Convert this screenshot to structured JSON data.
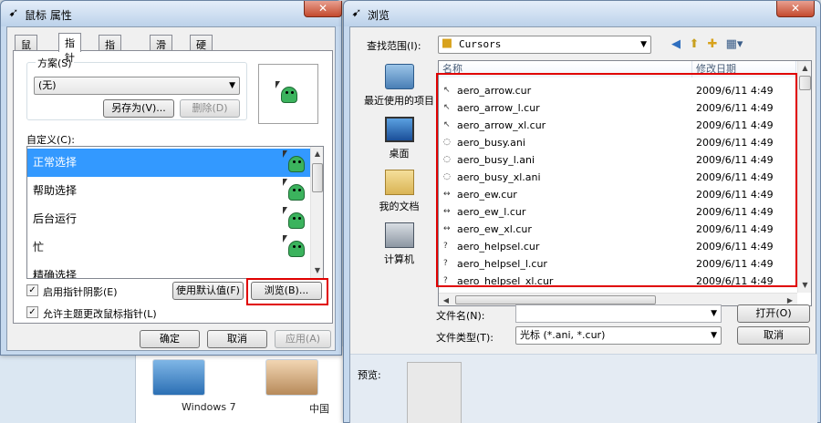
{
  "background": {
    "thumbs": [
      {
        "label": "Windows 7"
      },
      {
        "label": "中国"
      }
    ]
  },
  "mouse_props": {
    "title": "鼠标 属性",
    "close_label": "✕",
    "tabs": [
      "鼠标键",
      "指针",
      "指针选项",
      "滑轮",
      "硬件"
    ],
    "active_tab": "指针",
    "scheme_label": "方案(S)",
    "scheme_value": "(无)",
    "save_as_label": "另存为(V)...",
    "delete_label": "删除(D)",
    "customize_label": "自定义(C):",
    "cursors": [
      {
        "label": "正常选择",
        "selected": true
      },
      {
        "label": "帮助选择",
        "selected": false
      },
      {
        "label": "后台运行",
        "selected": false
      },
      {
        "label": "忙",
        "selected": false
      },
      {
        "label": "精确选择",
        "selected": false
      }
    ],
    "shadow_label": "启用指针阴影(E)",
    "shadow_checked": true,
    "theme_label": "允许主题更改鼠标指针(L)",
    "theme_checked": true,
    "use_default_label": "使用默认值(F)",
    "browse_label": "浏览(B)...",
    "ok_label": "确定",
    "cancel_label": "取消",
    "apply_label": "应用(A)"
  },
  "browse": {
    "title": "浏览",
    "close_label": "✕",
    "look_in_label": "查找范围(I):",
    "look_in_value": "Cursors",
    "places": [
      {
        "label": "最近使用的项目",
        "icon": "recent-items-icon"
      },
      {
        "label": "桌面",
        "icon": "desktop-icon"
      },
      {
        "label": "我的文档",
        "icon": "documents-icon"
      },
      {
        "label": "计算机",
        "icon": "computer-icon"
      }
    ],
    "columns": {
      "name": "名称",
      "date": "修改日期"
    },
    "files": [
      {
        "name": "aero_arrow.cur",
        "date": "2009/6/11 4:49",
        "icon": "↖"
      },
      {
        "name": "aero_arrow_l.cur",
        "date": "2009/6/11 4:49",
        "icon": "↖"
      },
      {
        "name": "aero_arrow_xl.cur",
        "date": "2009/6/11 4:49",
        "icon": "↖"
      },
      {
        "name": "aero_busy.ani",
        "date": "2009/6/11 4:49",
        "icon": "◌"
      },
      {
        "name": "aero_busy_l.ani",
        "date": "2009/6/11 4:49",
        "icon": "◌"
      },
      {
        "name": "aero_busy_xl.ani",
        "date": "2009/6/11 4:49",
        "icon": "◌"
      },
      {
        "name": "aero_ew.cur",
        "date": "2009/6/11 4:49",
        "icon": "↔"
      },
      {
        "name": "aero_ew_l.cur",
        "date": "2009/6/11 4:49",
        "icon": "↔"
      },
      {
        "name": "aero_ew_xl.cur",
        "date": "2009/6/11 4:49",
        "icon": "↔"
      },
      {
        "name": "aero_helpsel.cur",
        "date": "2009/6/11 4:49",
        "icon": "?"
      },
      {
        "name": "aero_helpsel_l.cur",
        "date": "2009/6/11 4:49",
        "icon": "?"
      },
      {
        "name": "aero_helpsel_xl.cur",
        "date": "2009/6/11 4:49",
        "icon": "?"
      }
    ],
    "filename_label": "文件名(N):",
    "filename_value": "",
    "filetype_label": "文件类型(T):",
    "filetype_value": "光标 (*.ani, *.cur)",
    "open_label": "打开(O)",
    "cancel_label": "取消",
    "preview_label": "预览:"
  },
  "highlight_color": "#e00000",
  "selection_color": "#3399ff"
}
